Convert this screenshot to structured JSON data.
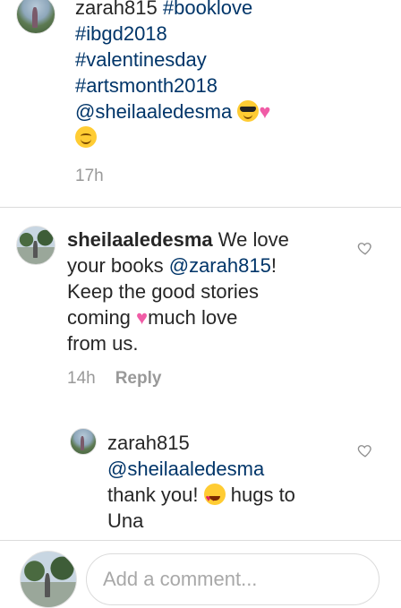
{
  "comments": [
    {
      "username": "zarah815",
      "tags": [
        "#booklove",
        "#ibgd2018",
        "#valentinesday",
        "#artsmonth2018"
      ],
      "mention": "@sheilaaledesma",
      "time": "17h"
    },
    {
      "username": "sheilaaledesma",
      "text_1": " We love",
      "text_2": "your books ",
      "mention": "@zarah815",
      "text_3": "!",
      "text_4": "Keep the good stories",
      "text_5": "coming ",
      "text_6": "much love",
      "text_7": "from us.",
      "time": "14h",
      "reply_label": "Reply"
    },
    {
      "username": "zarah815",
      "mention": "@sheilaaledesma",
      "text_1": "thank you! ",
      "text_2": " hugs to",
      "text_3": "Una"
    }
  ],
  "composer": {
    "placeholder": "Add a comment..."
  },
  "icons": {
    "like": "heart-outline-icon",
    "emoji_cool": "sunglasses-emoji-icon",
    "emoji_hearts": "two-hearts-emoji-icon",
    "emoji_smile": "smiling-face-emoji-icon",
    "emoji_sparkle_heart": "sparkling-heart-emoji-icon",
    "emoji_heart_eyes": "heart-eyes-emoji-icon"
  },
  "colors": {
    "text": "#262626",
    "hashtag": "#003569",
    "muted": "#999999"
  }
}
